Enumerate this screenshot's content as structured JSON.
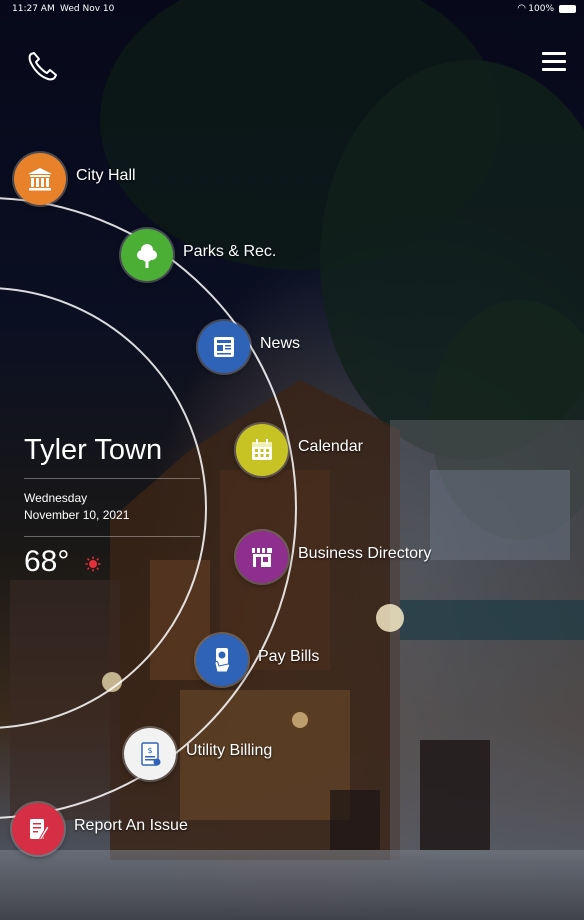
{
  "status_bar": {
    "time": "11:27 AM",
    "date": "Wed Nov 10",
    "battery": "100%"
  },
  "header": {
    "phone_icon": "phone-icon",
    "menu_icon": "hamburger-menu-icon"
  },
  "town": {
    "name": "Tyler Town",
    "weekday": "Wednesday",
    "date": "November 10, 2021",
    "temperature": "68°",
    "weather_icon": "sun-icon"
  },
  "nav": {
    "items": [
      {
        "label": "City Hall",
        "icon": "city-hall-icon",
        "color": "#E8822A"
      },
      {
        "label": "Parks & Rec.",
        "icon": "tree-icon",
        "color": "#4CAF35"
      },
      {
        "label": "News",
        "icon": "newspaper-icon",
        "color": "#2F63B8"
      },
      {
        "label": "Calendar",
        "icon": "calendar-icon",
        "color": "#C8C325"
      },
      {
        "label": "Business Directory",
        "icon": "storefront-icon",
        "color": "#8E2E8F"
      },
      {
        "label": "Pay Bills",
        "icon": "pay-bills-icon",
        "color": "#2F63B8"
      },
      {
        "label": "Utility Billing",
        "icon": "utility-bill-icon",
        "color": "#F2F2F2"
      },
      {
        "label": "Report An Issue",
        "icon": "report-issue-icon",
        "color": "#D62F45"
      }
    ]
  }
}
